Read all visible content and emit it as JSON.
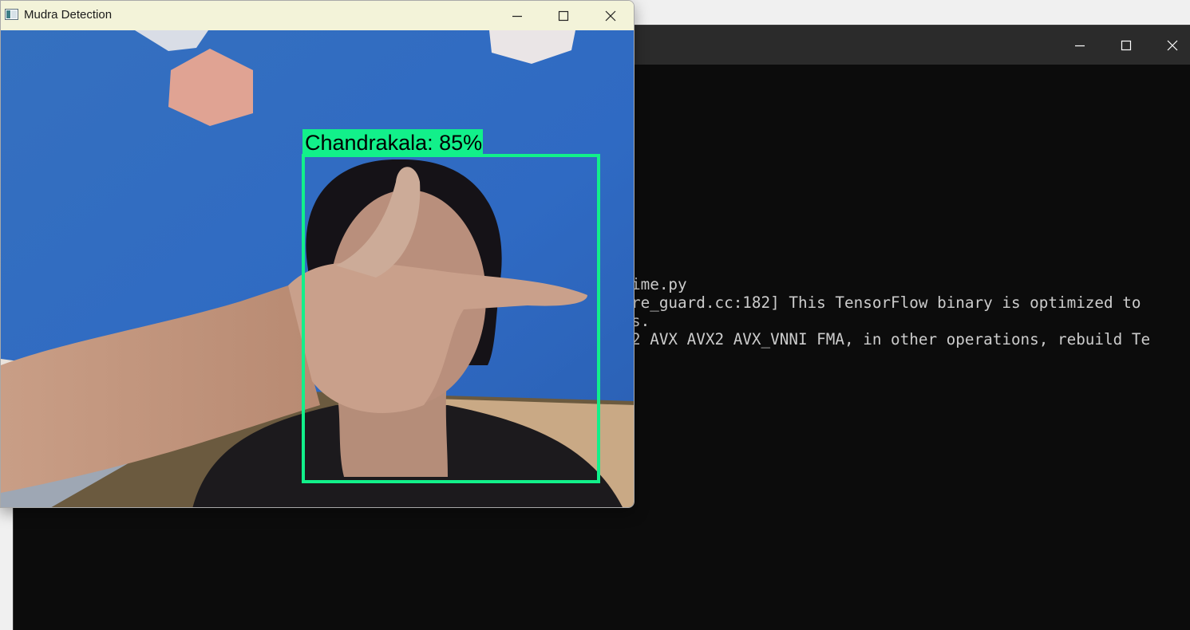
{
  "console": {
    "lines": [
      "ime.py",
      "re_guard.cc:182] This TensorFlow binary is optimized to",
      "s.",
      "2 AVX AVX2 AVX_VNNI FMA, in other operations, rebuild Te"
    ]
  },
  "mudra_window": {
    "title": "Mudra Detection",
    "detection": {
      "label": "Chandrakala: 85%",
      "mudra": "Chandrakala",
      "confidence": 0.85,
      "box_color": "#12f08a"
    }
  },
  "colors": {
    "console_bg": "#0c0c0c",
    "console_titlebar": "#2b2b2b",
    "console_text": "#cccccc",
    "mudra_titlebar": "#f3f3d9",
    "wall_blue": "#2f6fc4",
    "detection_green": "#12f08a"
  },
  "icons": {
    "minimize": "minimize-icon",
    "maximize": "maximize-icon",
    "close": "close-icon",
    "app": "app-window-icon"
  }
}
